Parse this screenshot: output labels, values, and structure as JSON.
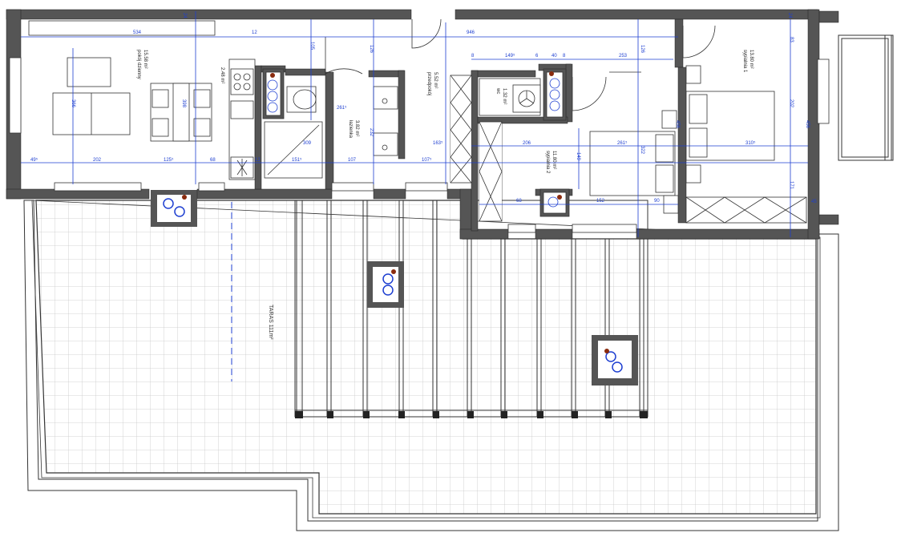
{
  "colors": {
    "wall": "#555555",
    "dim": "#1e3fd1",
    "grid": "#c8c8c8",
    "outline": "#333333",
    "red": "#8a2b0e"
  },
  "rooms": {
    "living_name": "pokój dzienny",
    "living_area": "15.58 m²",
    "kitchen_area": "2.48 m²",
    "hall_name": "przedpokój",
    "hall_area": "5.52 m²",
    "bath_name": "łazienka",
    "bath_area": "3.82 m²",
    "bed1_name": "sypialnia 1",
    "bed1_area": "13.80 m²",
    "bed2_name": "sypialnia 2",
    "bed2_area": "11.80 m²",
    "wc_name": "wc",
    "wc_area": "1.32 m²",
    "terrace_label": "TARAS 111m²"
  },
  "dims": {
    "d534": "534",
    "d12": "12",
    "d946": "946",
    "d149": "149⁵",
    "d40": "40",
    "d253": "253",
    "d83": "83",
    "d202": "202",
    "d456": "456",
    "d171": "171",
    "d45": "45",
    "d49": "49⁵",
    "d202b": "202",
    "d125": "125⁵",
    "d68": "68",
    "d12b": "12",
    "d151": "151⁵",
    "d107a": "107",
    "d107b": "107⁵",
    "d309": "309",
    "d163": "163⁵",
    "d261": "261⁵",
    "d261b": "261⁵",
    "d206": "206",
    "d310": "310⁵",
    "d152": "152",
    "d68b": "68",
    "d366": "366",
    "d398": "398",
    "d232": "232",
    "d126": "126",
    "d105": "105",
    "d149b": "149",
    "d322": "322",
    "d8": "8",
    "d6": "6",
    "d4": "4",
    "d14": "14",
    "d24": "24",
    "d29": "29",
    "d90": "90",
    "d9": "9"
  }
}
